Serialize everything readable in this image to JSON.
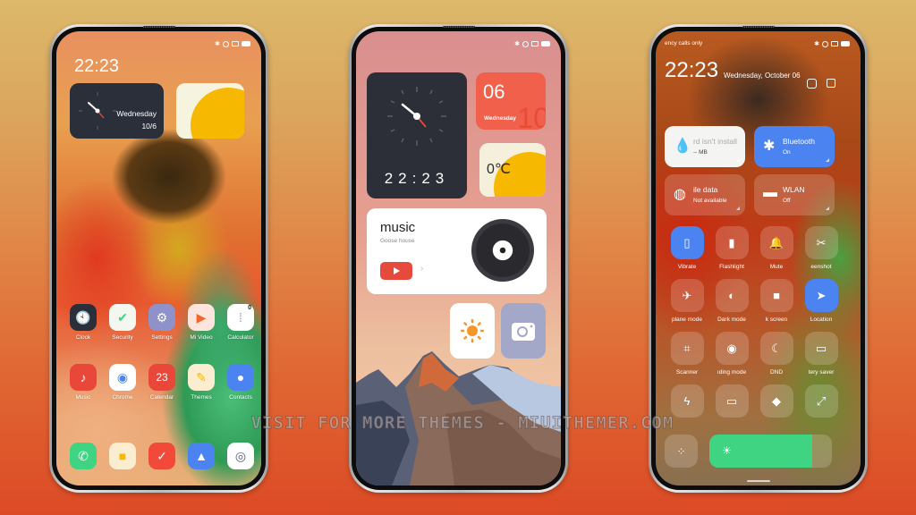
{
  "watermark": "VISIT FOR MORE THEMES - MIUITHEMER.COM",
  "phone1": {
    "lock_time": "22:23",
    "clock_widget": {
      "day": "Wednesday",
      "date": "10/6"
    },
    "apps_row1": [
      {
        "label": "Clock",
        "icon": "clock-icon",
        "color": "#2b2f3a"
      },
      {
        "label": "Security",
        "icon": "shield-check-icon",
        "color": "#f4f6f0"
      },
      {
        "label": "Settings",
        "icon": "gear-icon",
        "color": "#8f92c8"
      },
      {
        "label": "Mi Video",
        "icon": "video-play-icon",
        "color": "#fde4dc"
      },
      {
        "label": "Calculator",
        "icon": "calculator-icon",
        "color": "#ffffff",
        "badge": "0"
      }
    ],
    "apps_row2": [
      {
        "label": "Music",
        "icon": "music-note-icon",
        "color": "#e9473a"
      },
      {
        "label": "Chrome",
        "icon": "chrome-icon",
        "color": "#ffffff"
      },
      {
        "label": "Calendar",
        "icon": "calendar-icon",
        "color": "#e9473a",
        "text": "23"
      },
      {
        "label": "Themes",
        "icon": "paintbrush-icon",
        "color": "#fbeed0"
      },
      {
        "label": "Contacts",
        "icon": "contact-icon",
        "color": "#4b84f0"
      }
    ],
    "dock": [
      {
        "icon": "phone-icon",
        "color": "#3ed482"
      },
      {
        "icon": "messages-icon",
        "color": "#fbeed0"
      },
      {
        "icon": "notes-icon",
        "color": "#f24a3a"
      },
      {
        "icon": "gallery-icon",
        "color": "#4b84f0"
      },
      {
        "icon": "camera-icon",
        "color": "#ffffff"
      }
    ]
  },
  "phone2": {
    "digital_time": "22:23",
    "date_widget": {
      "day_num": "06",
      "ghost": "10",
      "weekday": "Wednesday"
    },
    "weather": {
      "temp": "0℃"
    },
    "music": {
      "title": "music",
      "artist": "Goose house",
      "chevron": "›"
    }
  },
  "phone3": {
    "carrier": "ency calls only",
    "time": "22:23",
    "date": "Wednesday, October 06",
    "tiles": [
      {
        "title": "rd isn't install",
        "sub": "-- MB",
        "icon": "water-drop-icon",
        "bg": "#f4f4f2",
        "fg": "#888"
      },
      {
        "title": "Bluetooth",
        "sub": "On",
        "icon": "bluetooth-icon",
        "bg": "#4b84f0",
        "fg": "#fff"
      },
      {
        "title": "ile data",
        "sub": "Not available",
        "icon": "globe-icon",
        "bg": "rgba(255,255,255,0.18)",
        "fg": "#fff"
      },
      {
        "title": "WLAN",
        "sub": "Off",
        "icon": "router-icon",
        "bg": "rgba(255,255,255,0.18)",
        "fg": "#fff"
      }
    ],
    "toggles": [
      {
        "label": "Vibrate",
        "icon": "vibrate-icon",
        "glyph": "▯",
        "on": true
      },
      {
        "label": "Flashlight",
        "icon": "flashlight-icon",
        "glyph": "▮",
        "on": false
      },
      {
        "label": "Mute",
        "icon": "bell-icon",
        "glyph": "🔔",
        "on": false
      },
      {
        "label": "eenshot",
        "icon": "screenshot-icon",
        "glyph": "✂",
        "on": false
      },
      {
        "label": "plane mode",
        "icon": "airplane-icon",
        "glyph": "✈",
        "on": false
      },
      {
        "label": "Dark mode",
        "icon": "dark-mode-icon",
        "glyph": "◐",
        "on": false
      },
      {
        "label": "k screen",
        "icon": "lock-icon",
        "glyph": "■",
        "on": false
      },
      {
        "label": "Location",
        "icon": "location-arrow-icon",
        "glyph": "➤",
        "on": true
      },
      {
        "label": "Scanner",
        "icon": "scanner-icon",
        "glyph": "⌗",
        "on": false
      },
      {
        "label": "ıding mode",
        "icon": "eye-icon",
        "glyph": "◉",
        "on": false
      },
      {
        "label": "DND",
        "icon": "moon-icon",
        "glyph": "☾",
        "on": false
      },
      {
        "label": "tery saver",
        "icon": "battery-saver-icon",
        "glyph": "▭",
        "on": false
      },
      {
        "label": "",
        "icon": "lightning-icon",
        "glyph": "ϟ",
        "on": false
      },
      {
        "label": "",
        "icon": "cast-icon",
        "glyph": "▭",
        "on": false
      },
      {
        "label": "",
        "icon": "diamond-icon",
        "glyph": "◆",
        "on": false
      },
      {
        "label": "",
        "icon": "expand-icon",
        "glyph": "⤢",
        "on": false
      }
    ],
    "brightness_fraction": 0.84
  }
}
